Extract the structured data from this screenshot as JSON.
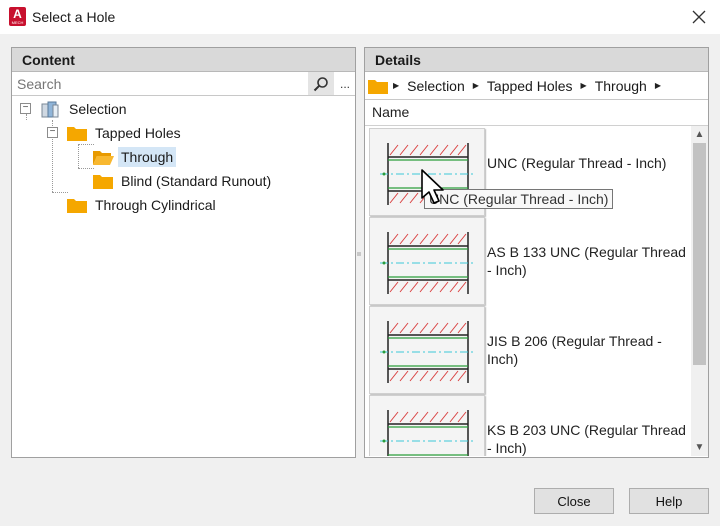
{
  "window": {
    "title": "Select a Hole",
    "app_icon_letter": "A",
    "app_icon_sub": "MECH"
  },
  "content_panel": {
    "header": "Content",
    "search_placeholder": "Search",
    "more_label": "...",
    "tree": {
      "root": "Selection",
      "tapped_holes": "Tapped Holes",
      "through": "Through",
      "blind": "Blind (Standard Runout)",
      "through_cylindrical": "Through Cylindrical"
    }
  },
  "details_panel": {
    "header": "Details",
    "breadcrumb": [
      "Selection",
      "Tapped Holes",
      "Through"
    ],
    "column_name": "Name",
    "items": [
      {
        "label": "UNC (Regular Thread - Inch)"
      },
      {
        "label": "AS B 133 UNC  (Regular Thread - Inch)"
      },
      {
        "label": "JIS B 206  (Regular Thread - Inch)"
      },
      {
        "label": "KS B 203 UNC  (Regular Thread - Inch)"
      }
    ],
    "tooltip": "UNC (Regular Thread - Inch)"
  },
  "buttons": {
    "close": "Close",
    "help": "Help"
  },
  "colors": {
    "folder": "#f5a700",
    "selected_bg": "#d4e6f6",
    "hatch_red": "#d94040",
    "thread_green": "#2a9d3a",
    "centerline_cyan": "#3cc8d8",
    "app_red": "#c8102e"
  }
}
